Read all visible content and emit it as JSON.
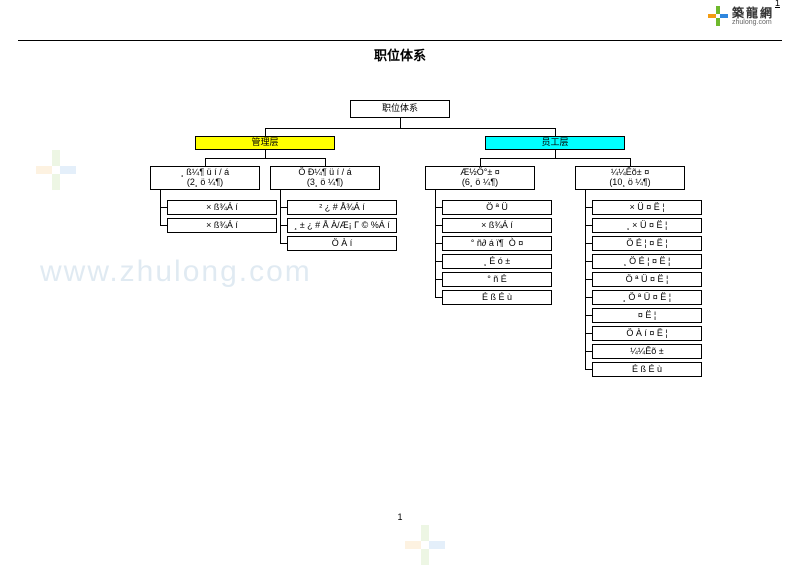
{
  "page_number_top": "1",
  "page_number_bottom": "1",
  "logo": {
    "cn": "築龍網",
    "en": "zhulong.com"
  },
  "title": "职位体系",
  "watermark_left": "www.zhulong.com",
  "chart_data": {
    "type": "tree",
    "root": "职位体系",
    "groups": [
      {
        "label": "管理层",
        "color": "#ffff00"
      },
      {
        "label": "员工层",
        "color": "#00ffff"
      }
    ],
    "subs": [
      {
        "group": 0,
        "line1": "¸ ß¼¶ ü í / á",
        "line2": "(2¸ ö ¼¶)"
      },
      {
        "group": 0,
        "line1": "Ö Ð¼¶ ü í / á",
        "line2": "(3¸ ö ¼¶)"
      },
      {
        "group": 1,
        "line1": "Æ½Ö°± ¤",
        "line2": "(6¸ ö ¼¶)"
      },
      {
        "group": 1,
        "line1": "¼¼Êõ± ¤",
        "line2": "(10¸ ö ¼¶)"
      }
    ],
    "leaves": {
      "col0": [
        "× ß¾Á í",
        "× ß¾Á í"
      ],
      "col1": [
        "² ¿ # Å¾Á í",
        "¸ ± ¿ # Å À/Æ¡ Γ © %Á í",
        "Ö À í"
      ],
      "col2": [
        "Ö ª Ü",
        "× ß¾Á í",
        "° ñ∂ á ï¶ ­ Ò ¤",
        "¸ É ó ±",
        "° ñ É",
        "É ß É ù"
      ],
      "col3": [
        "× Ü ¤ Ë ¦",
        "¸ × Ü ¤ Ë ¦",
        "Ö É ¦ ¤ Ë ¦",
        "¸ Ö É ¦ ¤ Ë ¦",
        "Ö ª Ü ¤ Ë ¦",
        "¸ Ö ª Ü ¤ Ë ¦",
        "¤ Ë ¦",
        "Ö À í ¤ Ë ¦",
        "¼¼Êõ ±",
        "É ß É ù"
      ]
    }
  }
}
